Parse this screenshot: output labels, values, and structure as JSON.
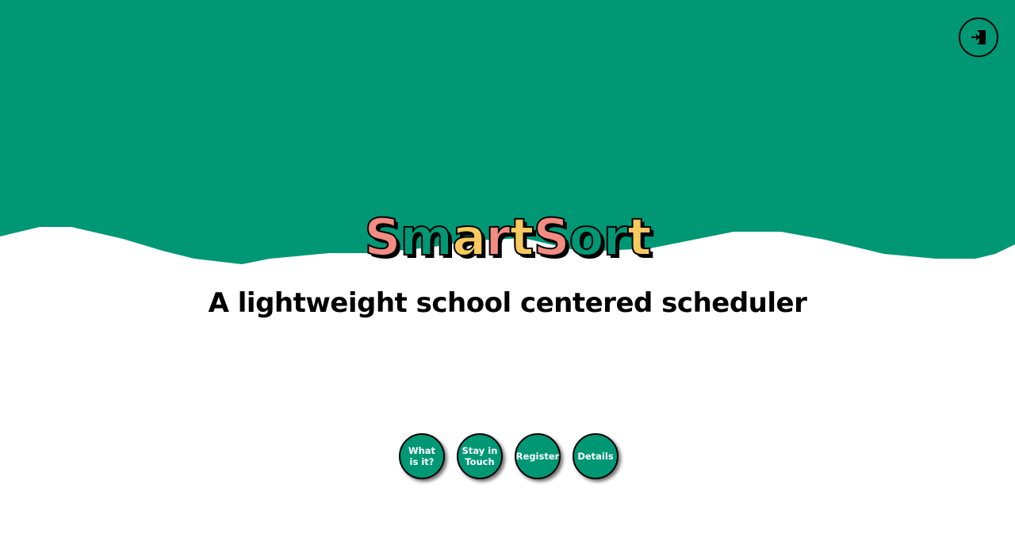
{
  "header": {
    "login_icon": "sign-in-icon",
    "background_color": "#009775"
  },
  "logo": {
    "text": "SmartSort",
    "colors": {
      "pink": "#f28c82",
      "yellow": "#f7c95e",
      "green": "#009775"
    }
  },
  "tagline": "A lightweight school centered scheduler",
  "nav": {
    "items": [
      {
        "label": "What is it?"
      },
      {
        "label": "Stay in Touch"
      },
      {
        "label": "Register"
      },
      {
        "label": "Details"
      }
    ]
  }
}
